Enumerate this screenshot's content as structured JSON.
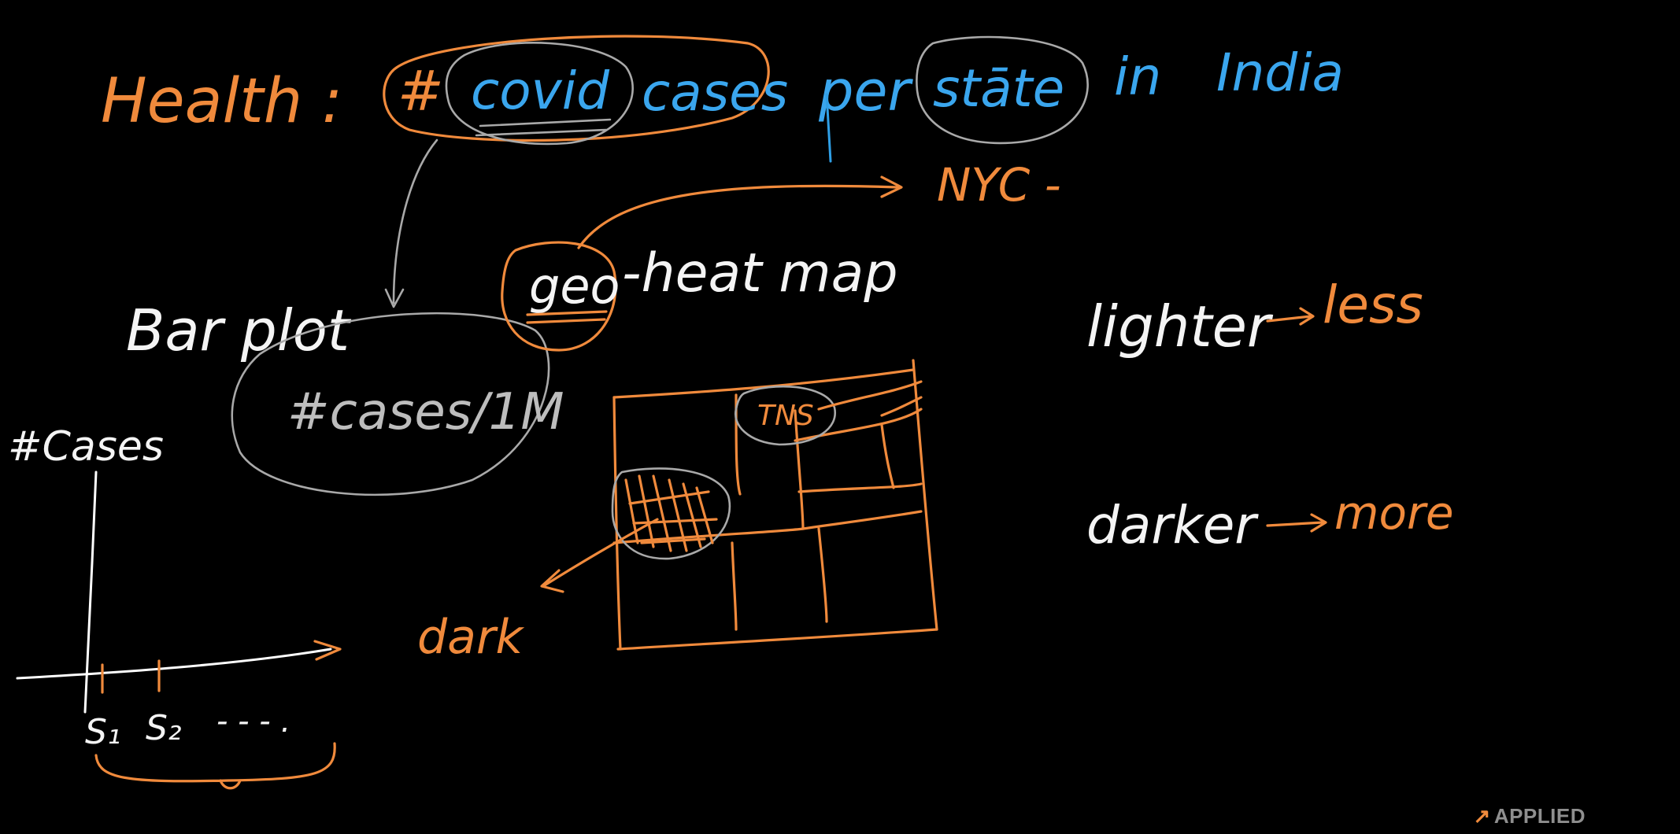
{
  "header": {
    "health_label": "Health :",
    "hash": "#",
    "covid": "covid",
    "cases": "cases",
    "per": "per",
    "state": "stāte",
    "in": "in",
    "india": "India"
  },
  "left": {
    "barplot": "Bar plot",
    "cases_per_million": "#cases/1M",
    "y_label": "#Cases",
    "s1": "S₁",
    "s2": "S₂",
    "ellipsis": "- - - ."
  },
  "center": {
    "nyc": "NYC -",
    "geo": "geo",
    "heat_map": "-heat map",
    "cell_label": "TNS",
    "dark": "dark"
  },
  "right": {
    "lighter": "lighter",
    "less": "less",
    "darker": "darker",
    "more": "more"
  },
  "watermark": {
    "text": "APPLIED"
  },
  "colors": {
    "background": "#000000",
    "orange_ink": "#f08a3c",
    "blue_ink": "#3aa6ee",
    "white_ink": "#ffffff",
    "gray_ink": "#a9a9a9"
  }
}
